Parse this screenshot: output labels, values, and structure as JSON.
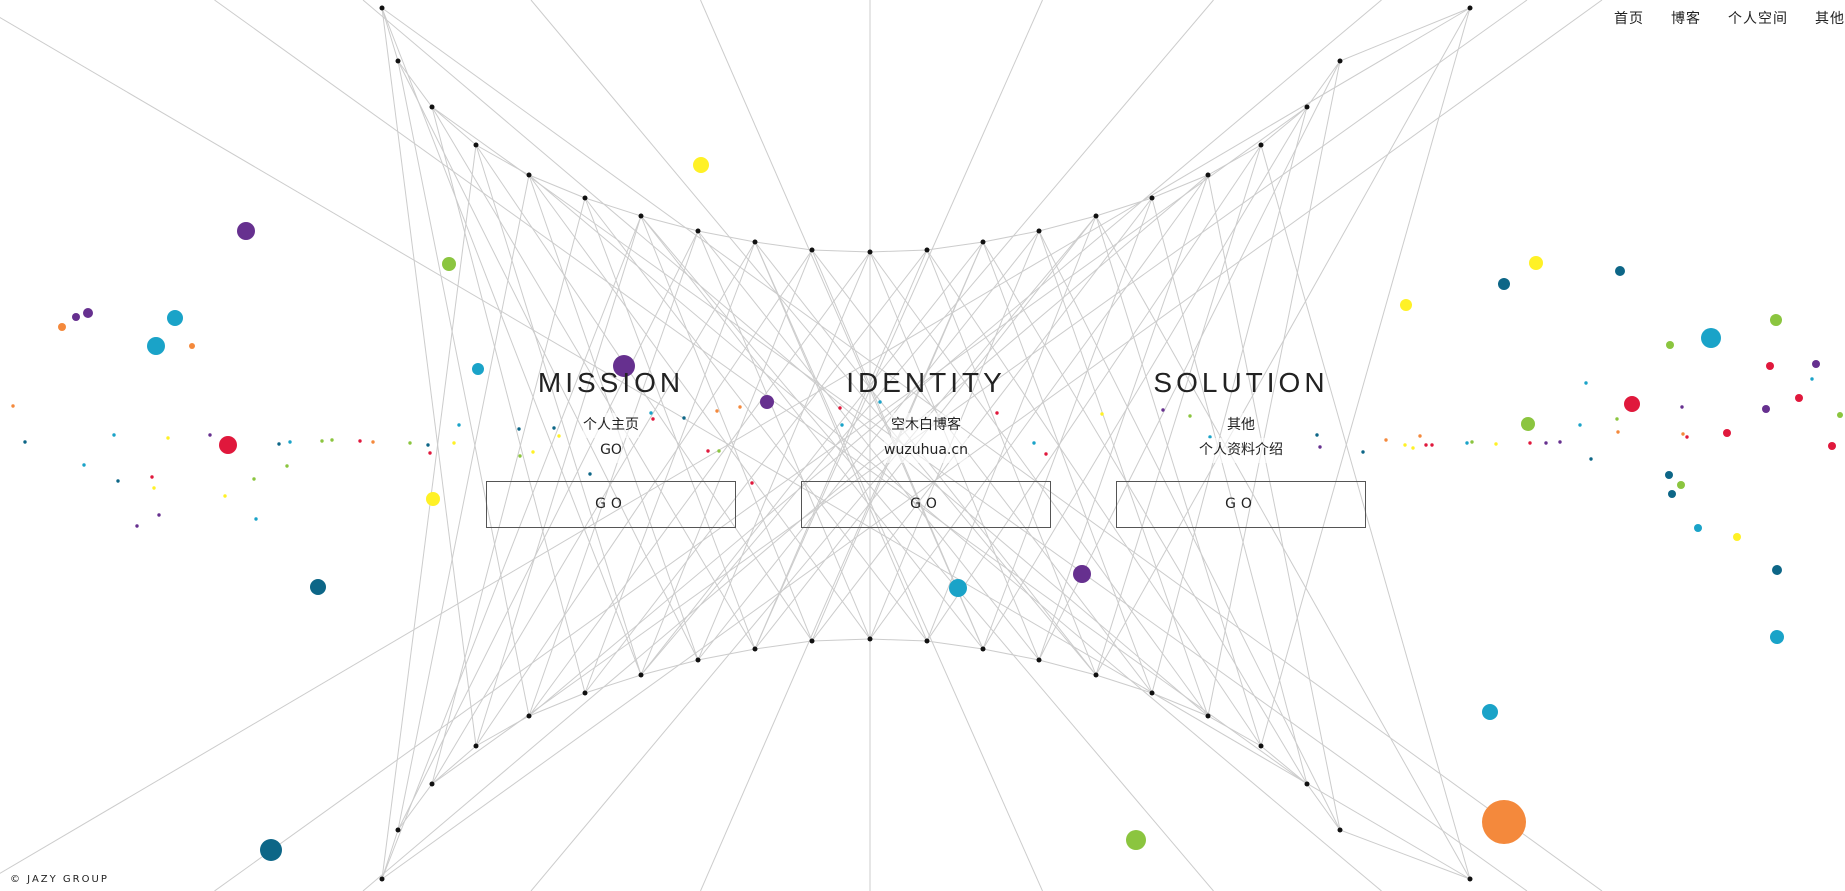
{
  "nav": {
    "items": [
      {
        "label": "首页"
      },
      {
        "label": "博客"
      },
      {
        "label": "个人空间"
      },
      {
        "label": "其他"
      }
    ]
  },
  "columns": [
    {
      "title": "MISSION",
      "line1": "个人主页",
      "line2": "GO",
      "button": "GO"
    },
    {
      "title": "IDENTITY",
      "line1": "空木白博客",
      "line2": "wuzuhua.cn",
      "button": "GO"
    },
    {
      "title": "SOLUTION",
      "line1": "其他",
      "line2": "个人资料介绍",
      "button": "GO"
    }
  ],
  "footer": {
    "copyright": "© JAZY GROUP"
  },
  "colors": {
    "line": "#cccccc",
    "dot": "#111111",
    "purple": "#66308f",
    "cyan": "#1aa3c8",
    "teal": "#0d6687",
    "green": "#8bc53f",
    "yellow": "#fff126",
    "red": "#e0183c",
    "orange": "#f4893c"
  }
}
